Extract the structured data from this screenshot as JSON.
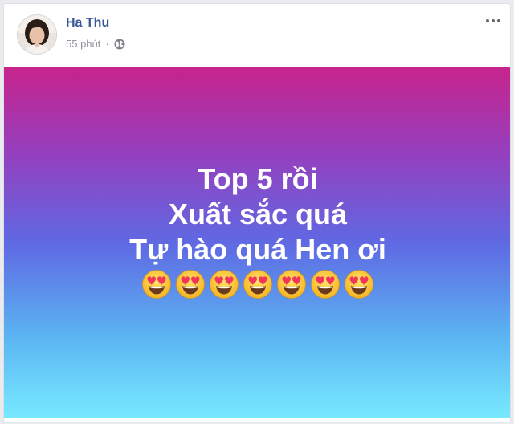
{
  "post": {
    "author": "Ha Thu",
    "time": "55 phút",
    "separator": "·",
    "privacy_icon": "globe-icon",
    "menu_icon": "more-horizontal-icon"
  },
  "status": {
    "lines": [
      "Top 5 rồi",
      "Xuất sắc quá",
      "Tự hào quá Hen ơi"
    ],
    "emoji_name": "heart-eyes-emoji",
    "emoji_count": 7,
    "background_colors": [
      "#c8238c",
      "#9440bf",
      "#5f69e3",
      "#5ab3f1",
      "#78ebff"
    ]
  },
  "colors": {
    "author": "#385898",
    "meta": "#90949c"
  }
}
